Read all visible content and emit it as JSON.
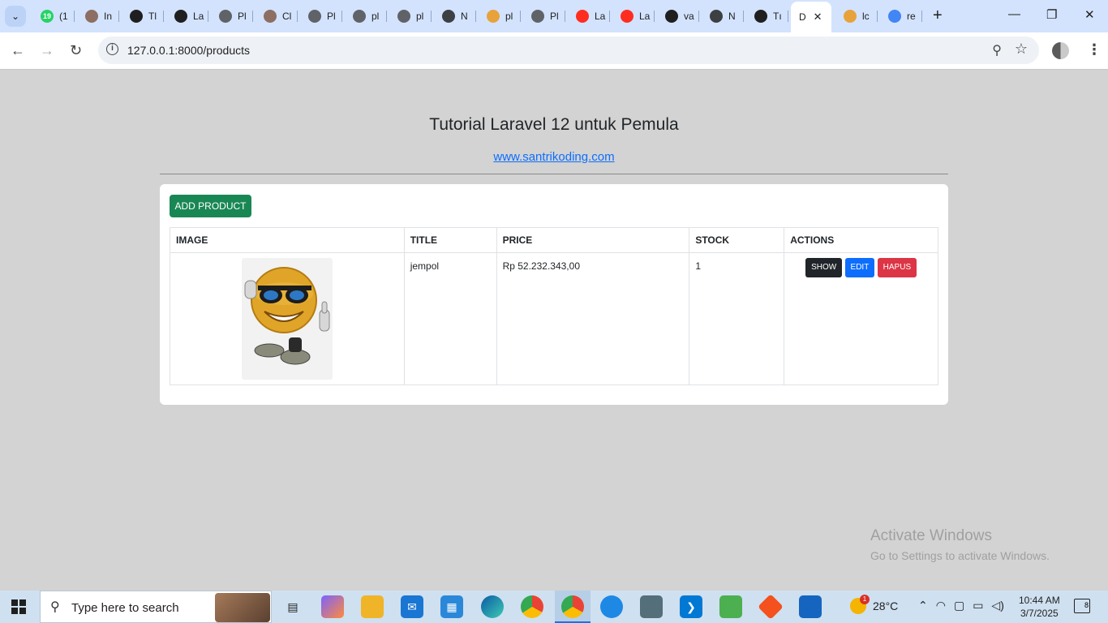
{
  "browser": {
    "tabs": [
      {
        "label": "(1",
        "fav": "whatsapp-icon",
        "color": "#25d366",
        "badge": "19"
      },
      {
        "label": "In",
        "fav": "avatar-icon",
        "color": "#8d6e63"
      },
      {
        "label": "Tl",
        "fav": "github-icon",
        "color": "#1f1f1f"
      },
      {
        "label": "La",
        "fav": "openai-icon",
        "color": "#1f1f1f"
      },
      {
        "label": "Pl",
        "fav": "globe-icon",
        "color": "#5f6368"
      },
      {
        "label": "Cl",
        "fav": "avatar-icon",
        "color": "#8d6e63"
      },
      {
        "label": "Pl",
        "fav": "globe-icon",
        "color": "#5f6368"
      },
      {
        "label": "pl",
        "fav": "globe-icon",
        "color": "#5f6368"
      },
      {
        "label": "pl",
        "fav": "globe-icon",
        "color": "#5f6368"
      },
      {
        "label": "N",
        "fav": "globe-icon",
        "color": "#3c4043"
      },
      {
        "label": "pl",
        "fav": "pma-icon",
        "color": "#e8a23b"
      },
      {
        "label": "Pl",
        "fav": "globe-icon",
        "color": "#5f6368"
      },
      {
        "label": "La",
        "fav": "laravel-icon",
        "color": "#ff2d20"
      },
      {
        "label": "La",
        "fav": "laravel-icon",
        "color": "#ff2d20"
      },
      {
        "label": "va",
        "fav": "github-icon",
        "color": "#1f1f1f"
      },
      {
        "label": "N",
        "fav": "globe-icon",
        "color": "#3c4043"
      },
      {
        "label": "Tı",
        "fav": "copilot-icon",
        "color": "#1f1f1f"
      },
      {
        "label": "D",
        "fav": "",
        "color": "",
        "active": true
      },
      {
        "label": "lc",
        "fav": "pma-icon",
        "color": "#e8a23b"
      },
      {
        "label": "re",
        "fav": "google-icon",
        "color": "#4285f4"
      }
    ],
    "url": "127.0.0.1:8000/products"
  },
  "page": {
    "heading": "Tutorial Laravel 12 untuk Pemula",
    "link": "www.santrikoding.com",
    "add_button": "ADD PRODUCT",
    "table": {
      "headers": [
        "IMAGE",
        "TITLE",
        "PRICE",
        "STOCK",
        "ACTIONS"
      ],
      "rows": [
        {
          "image": "emoji-sunglasses-thumbsup",
          "title": "jempol",
          "price": "Rp 52.232.343,00",
          "stock": "1"
        }
      ],
      "actions": {
        "show": "SHOW",
        "edit": "EDIT",
        "delete": "HAPUS"
      }
    },
    "watermark": {
      "title": "Activate Windows",
      "subtitle": "Go to Settings to activate Windows."
    }
  },
  "taskbar": {
    "search_placeholder": "Type here to search",
    "weather": "28°C",
    "weather_badge": "1",
    "time": "10:44 AM",
    "date": "3/7/2025",
    "notifications": "8"
  },
  "colors": {
    "success": "#198754",
    "primary": "#0d6efd",
    "danger": "#dc3545",
    "dark": "#212529"
  }
}
